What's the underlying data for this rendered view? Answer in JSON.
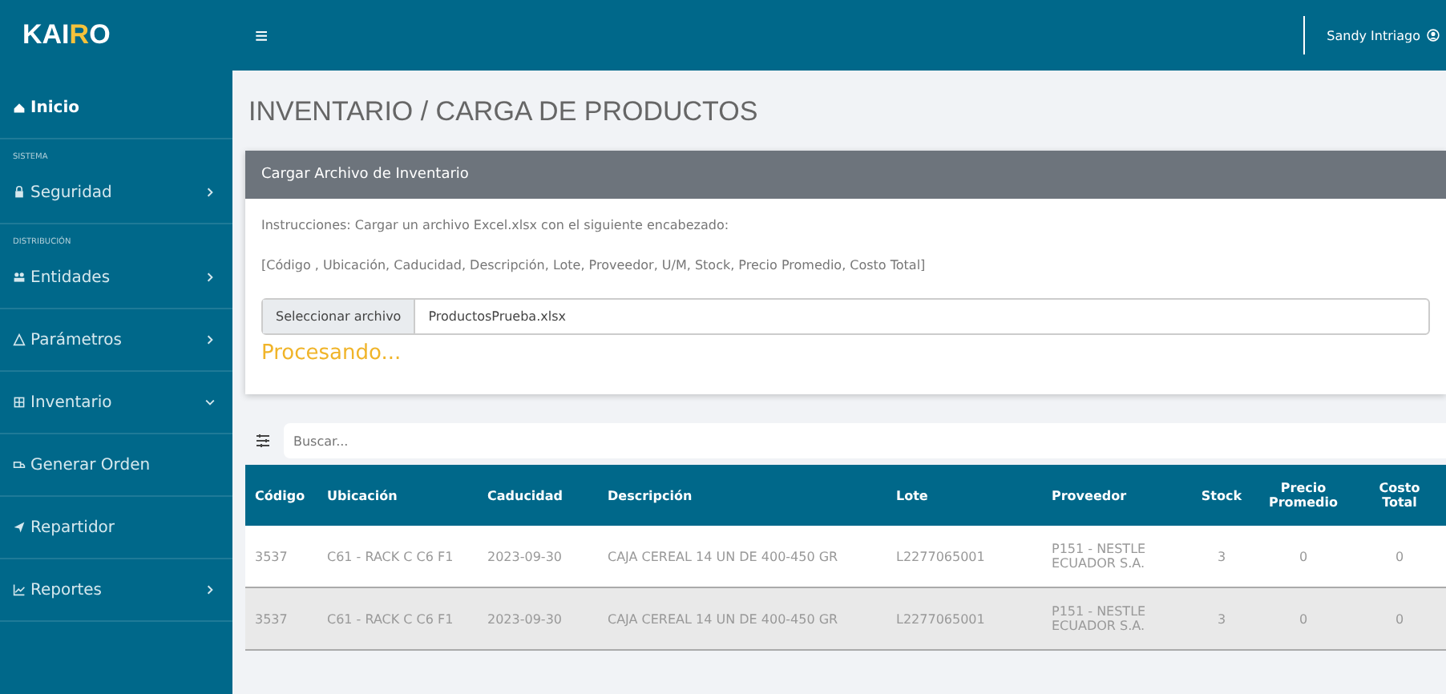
{
  "brand": {
    "main": "KAI",
    "accent": "R",
    "tail": "O"
  },
  "sidebar": {
    "items": [
      {
        "kind": "link",
        "label": "Inicio",
        "selected": true
      },
      {
        "kind": "section",
        "label": "SISTEMA"
      },
      {
        "kind": "menu",
        "label": "Seguridad",
        "selected": false,
        "expanded": false
      },
      {
        "kind": "section",
        "label": "DISTRIBUCIÓN"
      },
      {
        "kind": "menu",
        "label": "Entidades",
        "selected": false,
        "expanded": false
      },
      {
        "kind": "menu",
        "label": "Parámetros",
        "selected": false,
        "expanded": false
      },
      {
        "kind": "menu",
        "label": "Inventario",
        "selected": false,
        "expanded": true
      },
      {
        "kind": "link",
        "label": "Generar Orden",
        "selected": false
      },
      {
        "kind": "link",
        "label": "Repartidor",
        "selected": false
      },
      {
        "kind": "menu",
        "label": "Reportes",
        "selected": false,
        "expanded": false
      }
    ]
  },
  "topbar": {
    "menu_icon": "≡",
    "user": "Sandy Intriago"
  },
  "page_title": "INVENTARIO / CARGA DE PRODUCTOS",
  "card": {
    "header": "Cargar Archivo de Inventario",
    "instructions": "Instrucciones: Cargar un archivo Excel.xlsx con el siguiente encabezado:",
    "columns_hint": "[Código , Ubicación, Caducidad, Descripción, Lote, Proveedor, U/M, Stock, Precio Promedio, Costo Total]",
    "file_button": "Seleccionar archivo",
    "file_name": "ProductosPrueba.xlsx",
    "status": "Procesando..."
  },
  "search": {
    "placeholder": "Buscar..."
  },
  "table": {
    "columns": [
      "Código",
      "Ubicación",
      "Caducidad",
      "Descripción",
      "Lote",
      "Proveedor",
      "Stock",
      "Precio Promedio",
      "Costo Total"
    ],
    "rows": [
      [
        "3537",
        "C61 - RACK C C6 F1",
        "2023-09-30",
        "CAJA CEREAL 14 UN DE 400-450 GR",
        "L2277065001",
        "P151 - NESTLE ECUADOR S.A.",
        "3",
        "0",
        "0"
      ],
      [
        "3537",
        "C61 - RACK C C6 F1",
        "2023-09-30",
        "CAJA CEREAL 14 UN DE 400-450 GR",
        "L2277065001",
        "P151 - NESTLE ECUADOR S.A.",
        "3",
        "0",
        "0"
      ]
    ]
  }
}
